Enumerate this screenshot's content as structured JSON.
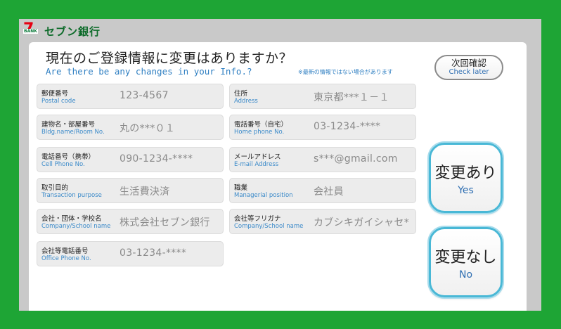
{
  "brand": {
    "name": "セブン銀行",
    "mark_number": "7",
    "mark_text": "BANK"
  },
  "header": {
    "title_jp": "現在のご登録情報に変更はありますか？",
    "title_en": "Are there be any changes in your Info.?",
    "note": "※最新の情報ではない場合があります"
  },
  "buttons": {
    "later_jp": "次回確認",
    "later_en": "Check later",
    "yes_jp": "変更あり",
    "yes_en": "Yes",
    "no_jp": "変更なし",
    "no_en": "No"
  },
  "fields": [
    {
      "label_jp": "郵便番号",
      "label_en": "Postal code",
      "value": "123-4567"
    },
    {
      "label_jp": "住所",
      "label_en": "Address",
      "value": "東京都***１－１"
    },
    {
      "label_jp": "建物名・部屋番号",
      "label_en": "Bldg.name/Room No.",
      "value": "丸の***０１"
    },
    {
      "label_jp": "電話番号（自宅）",
      "label_en": "Home phone No.",
      "value": "03-1234-****"
    },
    {
      "label_jp": "電話番号（携帯）",
      "label_en": "Cell Phone No.",
      "value": "090-1234-****"
    },
    {
      "label_jp": "メールアドレス",
      "label_en": "E-mail Address",
      "value": "s***@gmail.com"
    },
    {
      "label_jp": "取引目的",
      "label_en": "Transaction purpose",
      "value": "生活費決済"
    },
    {
      "label_jp": "職業",
      "label_en": "Managerial position",
      "value": "会社員"
    },
    {
      "label_jp": "会社・団体・学校名",
      "label_en": "Company/School name",
      "value": "株式会社セブン銀行"
    },
    {
      "label_jp": "会社等フリガナ",
      "label_en": "Company/School name",
      "value": "カブシキガイシャセ*"
    },
    {
      "label_jp": "会社等電話番号",
      "label_en": "Office Phone No.",
      "value": "03-1234-****"
    }
  ]
}
